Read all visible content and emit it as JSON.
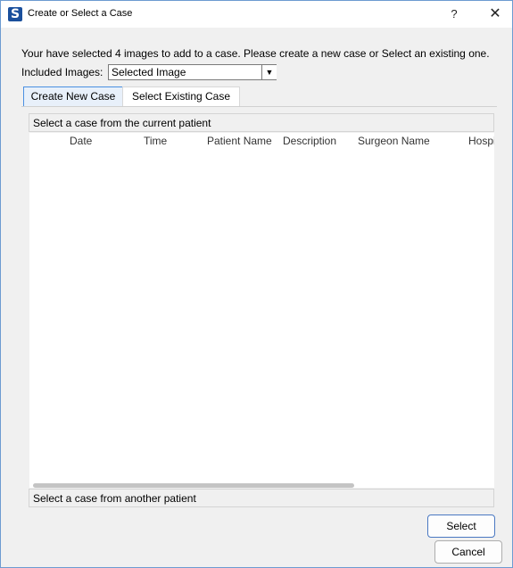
{
  "window": {
    "title": "Create or Select a Case",
    "app_icon_letter": "S",
    "help_label": "?",
    "close_label": "✕"
  },
  "message": "Your have selected 4 images to add to a case. Please create a new case or Select an existing one.",
  "included_images": {
    "label": "Included Images:",
    "selected_value": "Selected Image"
  },
  "tabs": [
    {
      "label": "Create New Case",
      "active": true
    },
    {
      "label": "Select Existing Case",
      "active": false
    }
  ],
  "current_patient_section": {
    "header": "Select a case from the current patient",
    "columns": [
      "Date",
      "Time",
      "Patient Name",
      "Description",
      "Surgeon Name",
      "Hospi"
    ],
    "rows": []
  },
  "other_patient_section": {
    "header": "Select a case from another patient"
  },
  "buttons": {
    "select": "Select",
    "cancel": "Cancel"
  },
  "colors": {
    "accent": "#4a90e2",
    "app_icon": "#1a4f9c"
  }
}
